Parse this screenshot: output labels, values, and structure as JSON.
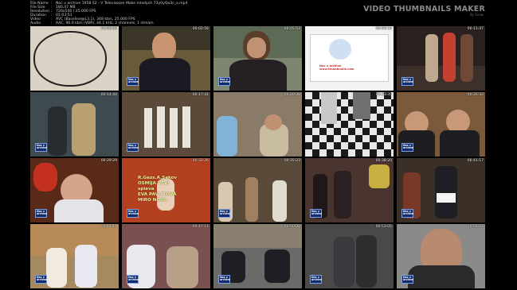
{
  "header": {
    "rows": [
      {
        "key": "File Name",
        "value": "Noc v archive 1958 S2 - V Televizoore Make mladych 73y0yQo3c_o.mp4"
      },
      {
        "key": "File Size",
        "value": "180,47 MB"
      },
      {
        "key": "Resolution",
        "value": "720x540 / 25.000 FPS"
      },
      {
        "key": "Duration",
        "value": "01:03:51"
      },
      {
        "key": "Video",
        "value": "AVC (Baseline@L3.1), 348 kb/s, 25.000 FPS"
      },
      {
        "key": "Audio",
        "value": "AAC, 96.0 kb/s (VBR), 44.1 kHz, 2 channels, 1 stream"
      }
    ],
    "brand": "VIDEO THUMBNAILS MAKER",
    "brand_sub": "By Snow"
  },
  "logo_text": "Noc v archive",
  "tiles": [
    {
      "timestamp": "00:00:03"
    },
    {
      "timestamp": "00:02:56"
    },
    {
      "timestamp": "00:05:53"
    },
    {
      "timestamp": "00:08:50"
    },
    {
      "timestamp": "00:11:47"
    },
    {
      "timestamp": "00:14:44"
    },
    {
      "timestamp": "00:17:41"
    },
    {
      "timestamp": "00:20:38"
    },
    {
      "timestamp": "00:23:35"
    },
    {
      "timestamp": "00:26:32"
    },
    {
      "timestamp": "00:29:29"
    },
    {
      "timestamp": "00:32:26"
    },
    {
      "timestamp": "00:35:23"
    },
    {
      "timestamp": "00:38:20"
    },
    {
      "timestamp": "00:41:17"
    },
    {
      "timestamp": "00:44:14"
    },
    {
      "timestamp": "00:47:11"
    },
    {
      "timestamp": "00:50:08"
    },
    {
      "timestamp": "00:53:05"
    },
    {
      "timestamp": "00:56:02"
    }
  ],
  "tile_colors": [
    "#d9d2c5",
    "#6a5a3c",
    "#7c8670",
    "#f2f2f2",
    "#3d2f2a",
    "#3f4a4f",
    "#5b4a3a",
    "#8a7a68",
    "#9a9a9a",
    "#7a5a3a",
    "#5a2a18",
    "#b3401e",
    "#5a4a3a",
    "#4a3430",
    "#3a3028",
    "#a58a60",
    "#7a5050",
    "#6a6a68",
    "#4a4848",
    "#8a8a88"
  ],
  "captions": {
    "title_card": {
      "line1": "Noc v archive",
      "line2": "www.thumbnails.com"
    },
    "credits": {
      "line1": "R.Gezs.A.Sakov",
      "line2": "OSMIJA VEVI",
      "line3": "spieva",
      "line4": "EVA PAVLÍKOVÁ",
      "line5": "MIRO NOGA"
    }
  }
}
